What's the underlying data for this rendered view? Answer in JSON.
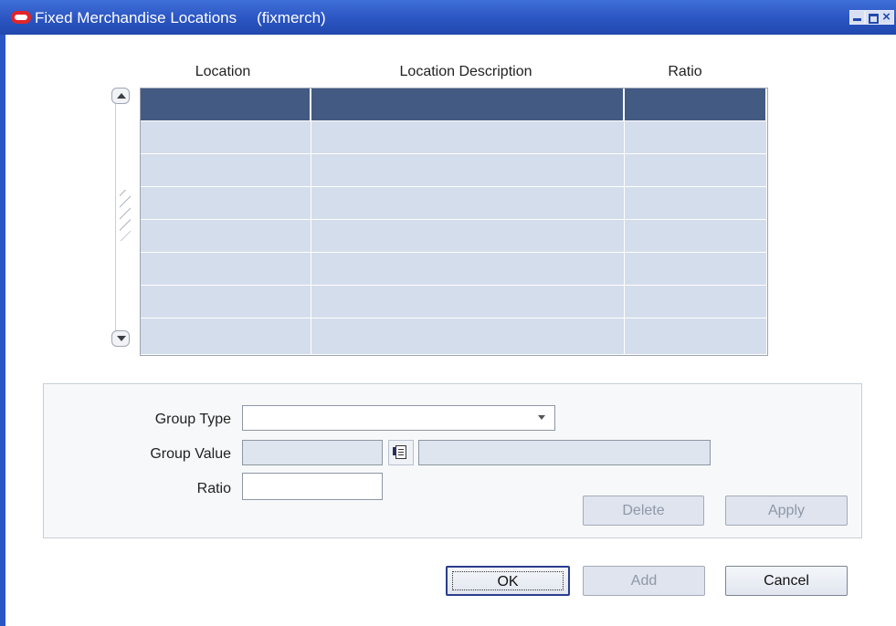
{
  "window": {
    "title": "Fixed Merchandise Locations",
    "form_code": "(fixmerch)",
    "controls": [
      "minimize-icon",
      "maximize-icon",
      "close-icon"
    ]
  },
  "table": {
    "columns": [
      "Location",
      "Location Description",
      "Ratio"
    ],
    "rows": [
      [
        "",
        "",
        ""
      ],
      [
        "",
        "",
        ""
      ],
      [
        "",
        "",
        ""
      ],
      [
        "",
        "",
        ""
      ],
      [
        "",
        "",
        ""
      ],
      [
        "",
        "",
        ""
      ],
      [
        "",
        "",
        ""
      ],
      [
        "",
        "",
        ""
      ]
    ]
  },
  "form": {
    "group_type_label": "Group Type",
    "group_type_value": "",
    "group_value_label": "Group Value",
    "group_value_value": "",
    "group_value_desc": "",
    "ratio_label": "Ratio",
    "ratio_value": ""
  },
  "buttons": {
    "delete": "Delete",
    "apply": "Apply",
    "ok": "OK",
    "add": "Add",
    "cancel": "Cancel"
  },
  "colors": {
    "titlebar": "#2b55c2",
    "selected_row": "#435a83",
    "grid_cell": "#d4ddec",
    "disabled_field": "#dfe5ef"
  }
}
